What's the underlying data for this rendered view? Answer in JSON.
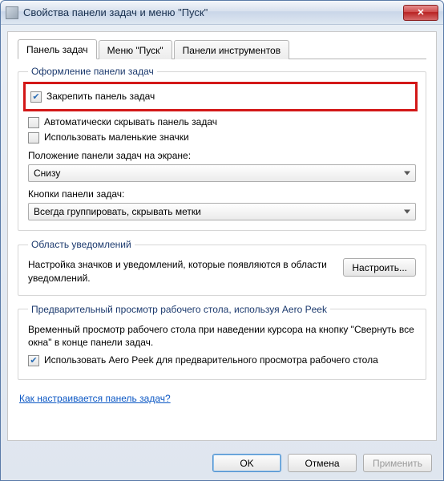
{
  "titlebar": {
    "title": "Свойства панели задач и меню \"Пуск\"",
    "close": "✕"
  },
  "tabs": {
    "taskbar": "Панель задач",
    "start": "Меню \"Пуск\"",
    "toolbars": "Панели инструментов"
  },
  "appearance": {
    "legend": "Оформление панели задач",
    "lock": "Закрепить панель задач",
    "autohide": "Автоматически скрывать панель задач",
    "smallicons": "Использовать маленькие значки",
    "position_label": "Положение панели задач на экране:",
    "position_value": "Снизу",
    "buttons_label": "Кнопки панели задач:",
    "buttons_value": "Всегда группировать, скрывать метки"
  },
  "notifications": {
    "legend": "Область уведомлений",
    "desc": "Настройка значков и уведомлений, которые появляются в области уведомлений.",
    "customize": "Настроить..."
  },
  "aeropeek": {
    "legend": "Предварительный просмотр рабочего стола, используя Aero Peek",
    "desc": "Временный просмотр рабочего стола при наведении курсора на кнопку \"Свернуть все окна\" в конце панели задач.",
    "checkbox": "Использовать Aero Peek для предварительного просмотра рабочего стола"
  },
  "help_link": "Как настраивается панель задач?",
  "buttons": {
    "ok": "OK",
    "cancel": "Отмена",
    "apply": "Применить"
  }
}
